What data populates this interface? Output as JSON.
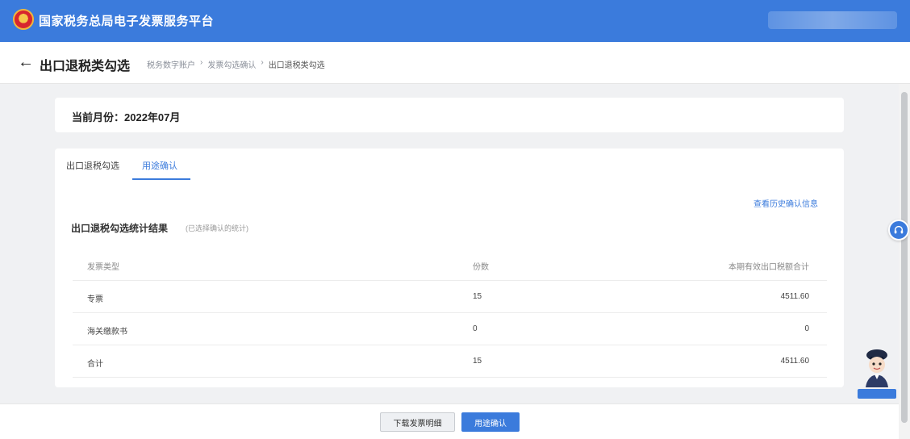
{
  "header": {
    "brand": "国家税务总局电子发票服务平台"
  },
  "subheader": {
    "back_icon": "←",
    "title": "出口退税类勾选",
    "breadcrumb": [
      "税务数字账户",
      "发票勾选确认",
      "出口退税类勾选"
    ]
  },
  "period": {
    "label": "当前月份：2022年07月"
  },
  "tabs": [
    {
      "label": "出口退税勾选",
      "active": false
    },
    {
      "label": "用途确认",
      "active": true
    }
  ],
  "history_link": "查看历史确认信息",
  "stats": {
    "title": "出口退税勾选统计结果",
    "note": "(已选择确认的统计)",
    "columns": [
      "发票类型",
      "份数",
      "本期有效出口税额合计"
    ],
    "rows": [
      [
        "专票",
        "15",
        "4511.60"
      ],
      [
        "海关缴款书",
        "0",
        "0"
      ],
      [
        "合计",
        "15",
        "4511.60"
      ]
    ]
  },
  "footer": {
    "download_label": "下载发票明细",
    "confirm_label": "用途确认"
  },
  "colors": {
    "primary": "#3b7bdc",
    "background": "#f0f1f3"
  }
}
